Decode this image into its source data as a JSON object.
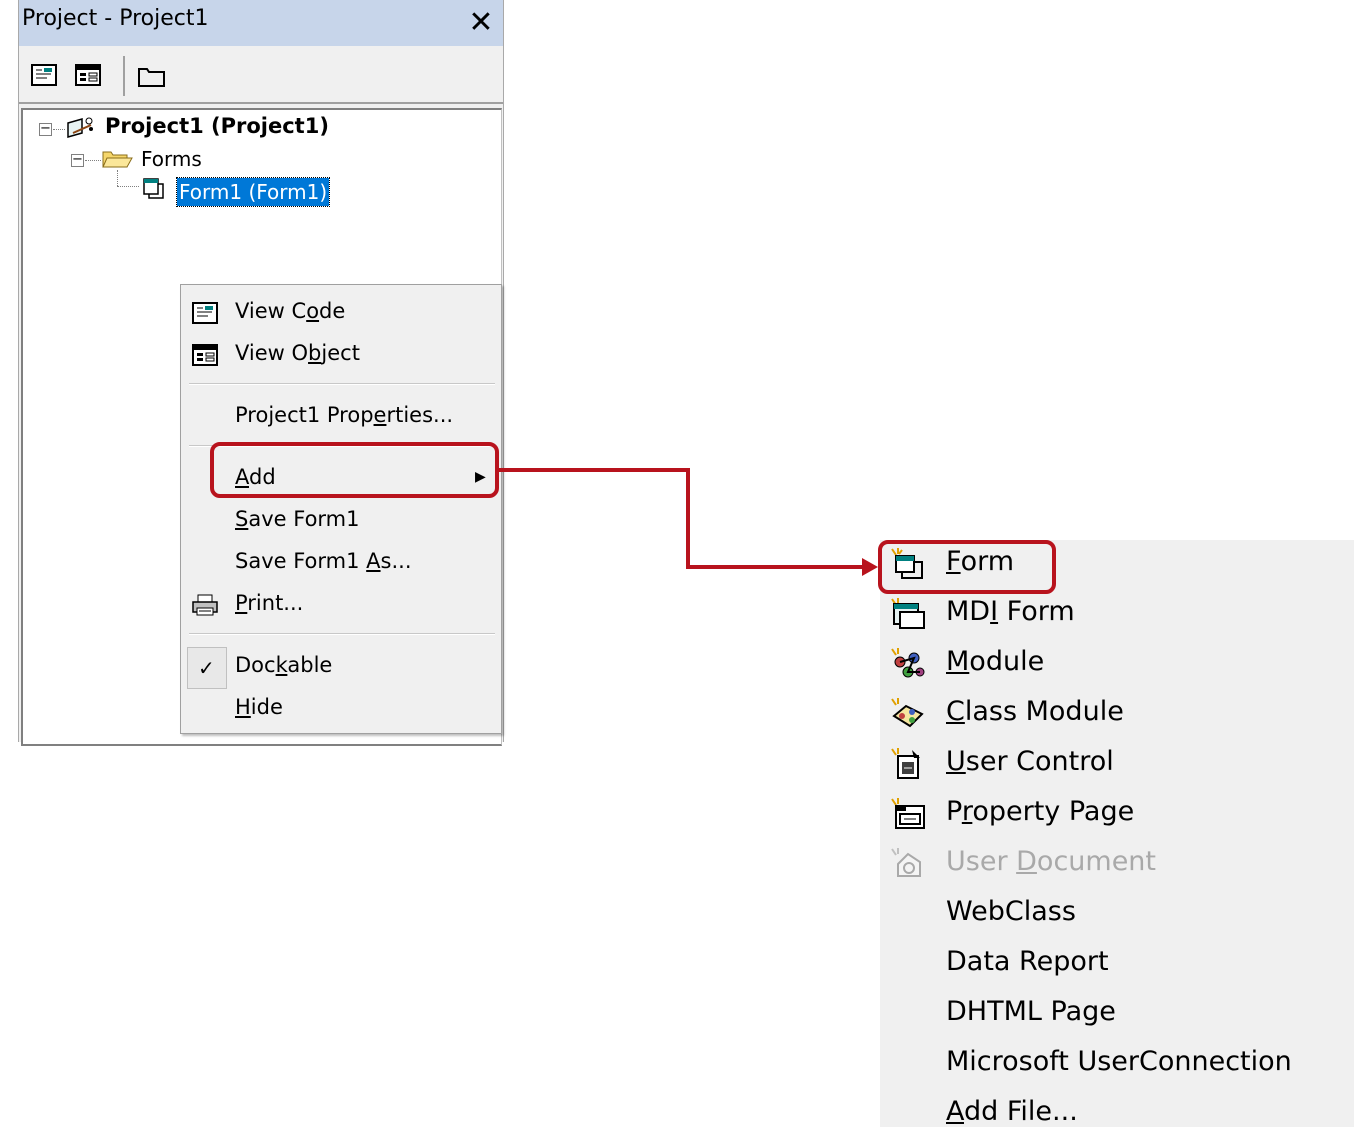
{
  "window": {
    "title": "Project - Project1",
    "close_label": "✕"
  },
  "tree": {
    "project": "Project1 (Project1)",
    "folder": "Forms",
    "form": "Form1 (Form1)"
  },
  "context_menu": {
    "items": {
      "view_code": {
        "pre": "View C",
        "ul": "o",
        "post": "de"
      },
      "view_object": {
        "pre": "View O",
        "ul": "b",
        "post": "ject"
      },
      "properties": {
        "pre": "Project1 Prop",
        "ul": "e",
        "post": "rties..."
      },
      "add": {
        "pre": "",
        "ul": "A",
        "post": "dd"
      },
      "save": {
        "pre": "",
        "ul": "S",
        "post": "ave Form1"
      },
      "save_as": {
        "pre": "Save Form1 ",
        "ul": "A",
        "post": "s..."
      },
      "print": {
        "pre": "",
        "ul": "P",
        "post": "rint..."
      },
      "dockable": {
        "pre": "Doc",
        "ul": "k",
        "post": "able"
      },
      "hide": {
        "pre": "",
        "ul": "H",
        "post": "ide"
      }
    },
    "check_mark": "✓",
    "submenu_arrow": "▶"
  },
  "add_submenu": {
    "items": {
      "form": {
        "pre": "",
        "ul": "F",
        "post": "orm"
      },
      "mdi_form": {
        "pre": "MD",
        "ul": "I",
        "post": " Form"
      },
      "module": {
        "pre": "",
        "ul": "M",
        "post": "odule"
      },
      "class_module": {
        "pre": "",
        "ul": "C",
        "post": "lass Module"
      },
      "user_control": {
        "pre": "",
        "ul": "U",
        "post": "ser Control"
      },
      "property_page": {
        "pre": "P",
        "ul": "r",
        "post": "operty Page"
      },
      "user_document": {
        "pre": "User ",
        "ul": "D",
        "post": "ocument"
      },
      "webclass": {
        "pre": "WebClass",
        "ul": "",
        "post": ""
      },
      "data_report": {
        "pre": "Data Report",
        "ul": "",
        "post": ""
      },
      "dhtml_page": {
        "pre": "DHTML Page",
        "ul": "",
        "post": ""
      },
      "user_connection": {
        "pre": "Microsoft UserConnection",
        "ul": "",
        "post": ""
      },
      "add_file": {
        "pre": "",
        "ul": "A",
        "post": "dd File..."
      }
    }
  },
  "colors": {
    "highlight_box": "#b8131d",
    "selection": "#0078d7",
    "title_bar": "#c7d5ea"
  }
}
